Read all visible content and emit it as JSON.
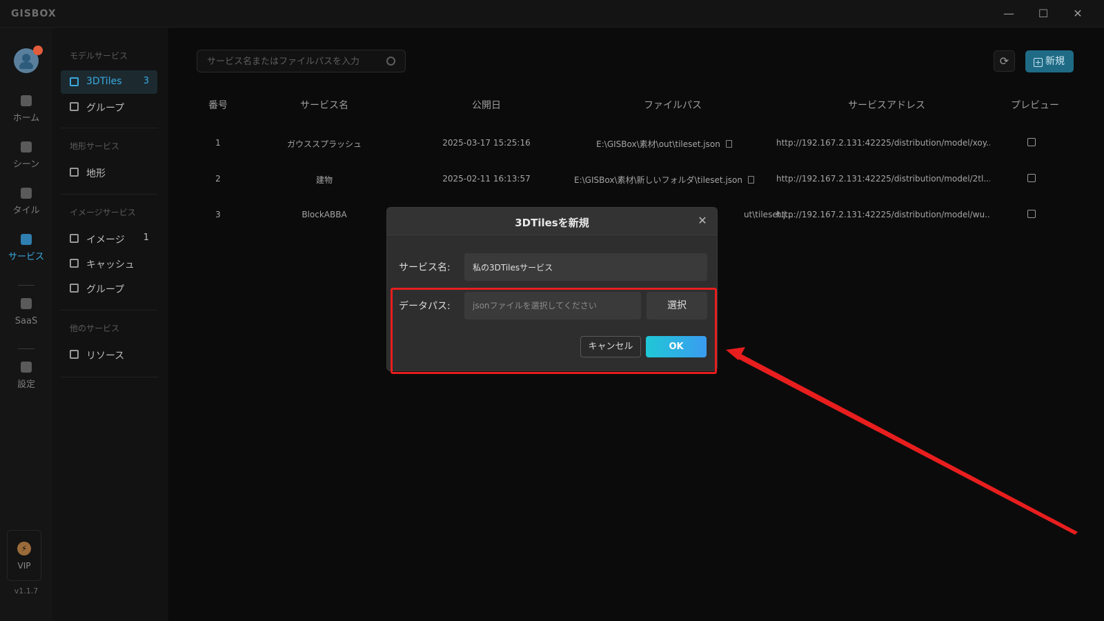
{
  "app": {
    "logo": "GISBOX",
    "version": "v1.1.7"
  },
  "window_controls": {
    "minimize": "—",
    "maximize": "☐",
    "close": "✕"
  },
  "rail": {
    "items": [
      {
        "label": "ホーム",
        "icon": "home-icon"
      },
      {
        "label": "シーン",
        "icon": "scene-icon"
      },
      {
        "label": "タイル",
        "icon": "tile-icon"
      },
      {
        "label": "サービス",
        "icon": "service-icon",
        "active": true
      },
      {
        "label": "SaaS",
        "icon": "lock-icon"
      },
      {
        "label": "設定",
        "icon": "settings-icon"
      }
    ],
    "vip": {
      "label": "VIP",
      "icon": "lightning-icon"
    }
  },
  "sidebar": {
    "sections": [
      {
        "title": "モデルサービス"
      },
      {
        "title": "地形サービス"
      },
      {
        "title": "イメージサービス"
      },
      {
        "title": "他のサービス"
      }
    ],
    "items": [
      {
        "label": "3DTiles",
        "count": "3",
        "active": true
      },
      {
        "label": "グループ",
        "count": ""
      },
      {
        "label": "地形",
        "count": ""
      },
      {
        "label": "イメージ",
        "count": "1"
      },
      {
        "label": "キャッシュ",
        "count": ""
      },
      {
        "label": "グループ",
        "count": ""
      },
      {
        "label": "リソース",
        "count": ""
      }
    ]
  },
  "search": {
    "placeholder": "サービス名またはファイルパスを入力"
  },
  "toolbar": {
    "new_label": "新規",
    "refresh_icon": "refresh-icon"
  },
  "table": {
    "headers": [
      "番号",
      "サービス名",
      "公開日",
      "ファイルパス",
      "サービスアドレス",
      "プレビュー"
    ],
    "rows": [
      {
        "no": "1",
        "name": "ガウススプラッシュ",
        "date": "2025-03-17 15:25:16",
        "path": "E:\\GISBox\\素材\\out\\tileset.json",
        "address": "http://192.167.2.131:42225/distribution/model/xoy..."
      },
      {
        "no": "2",
        "name": "建物",
        "date": "2025-02-11 16:13:57",
        "path": "E:\\GISBox\\素材\\新しいフォルダ\\tileset.json",
        "address": "http://192.167.2.131:42225/distribution/model/2tl..."
      },
      {
        "no": "3",
        "name": "BlockABBA",
        "date": "",
        "path": "ut\\tileset.j...",
        "address": "http://192.167.2.131:42225/distribution/model/wu..."
      }
    ]
  },
  "dialog": {
    "title": "3DTilesを新規",
    "service_name_label": "サービス名:",
    "service_name_value": "私の3DTilesサービス",
    "data_path_label": "データパス:",
    "data_path_placeholder": "jsonファイルを選択してください",
    "select_label": "選択",
    "cancel_label": "キャンセル",
    "ok_label": "OK"
  },
  "annotation": {
    "color": "#e81e1e"
  }
}
